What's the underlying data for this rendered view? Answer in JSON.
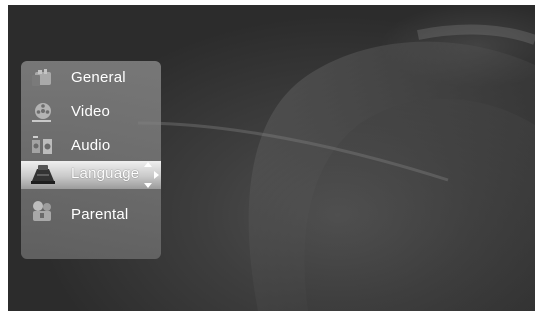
{
  "menu": {
    "items": [
      {
        "label": "General",
        "icon": "general-settings-icon"
      },
      {
        "label": "Video",
        "icon": "film-reel-icon"
      },
      {
        "label": "Audio",
        "icon": "speakers-icon"
      },
      {
        "label": "Language",
        "icon": "language-keyboard-icon"
      },
      {
        "label": "Parental",
        "icon": "parental-lock-icon"
      }
    ],
    "selected_index": 3
  },
  "colors": {
    "panel": "#8a8a8a",
    "highlight": "#dcdcdc",
    "text": "#ffffff",
    "background": "#333333"
  }
}
